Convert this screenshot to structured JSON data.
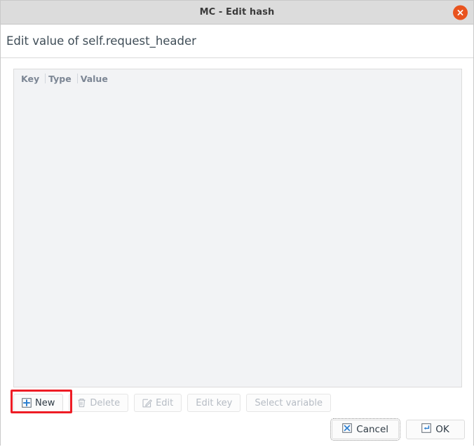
{
  "window": {
    "title": "MC - Edit hash",
    "close_icon": "close-x-icon",
    "accent_close": "#e9541f"
  },
  "header": {
    "title": "Edit value of self.request_header"
  },
  "list": {
    "columns": [
      "Key",
      "Type",
      "Value"
    ],
    "rows": []
  },
  "toolbar": {
    "buttons": [
      {
        "label": "New",
        "icon": "plus-box-icon",
        "enabled": true,
        "highlighted": true
      },
      {
        "label": "Delete",
        "icon": "trash-icon",
        "enabled": false,
        "highlighted": false
      },
      {
        "label": "Edit",
        "icon": "pencil-edit-icon",
        "enabled": false,
        "highlighted": false
      },
      {
        "label": "Edit key",
        "icon": "",
        "enabled": false,
        "highlighted": false
      },
      {
        "label": "Select variable",
        "icon": "",
        "enabled": false,
        "highlighted": false
      }
    ],
    "highlight_color": "#ee1c25"
  },
  "footer": {
    "cancel_label": "Cancel",
    "cancel_icon": "cancel-x-box-icon",
    "ok_label": "OK",
    "ok_icon": "enter-return-icon"
  }
}
